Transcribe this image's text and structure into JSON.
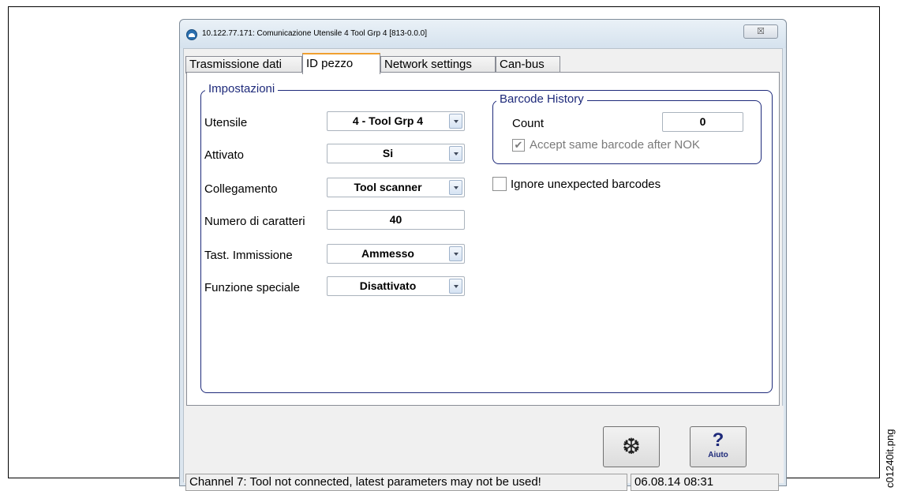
{
  "side_label": "c01240it.png",
  "window": {
    "title": "10.122.77.171: Comunicazione  Utensile 4  Tool Grp 4 [813-0.0.0]",
    "close_glyph": "☒"
  },
  "tabs": [
    {
      "label": "Trasmissione dati"
    },
    {
      "label": "ID pezzo"
    },
    {
      "label": "Network settings"
    },
    {
      "label": "Can-bus"
    }
  ],
  "impostazioni": {
    "title": "Impostazioni",
    "utensile": {
      "label": "Utensile",
      "value": "4 - Tool Grp 4"
    },
    "attivato": {
      "label": "Attivato",
      "value": "Si"
    },
    "collegamento": {
      "label": "Collegamento",
      "value": "Tool scanner"
    },
    "numero": {
      "label": "Numero di caratteri",
      "value": "40"
    },
    "tast": {
      "label": "Tast. Immissione",
      "value": "Ammesso"
    },
    "funzione": {
      "label": "Funzione speciale",
      "value": "Disattivato"
    }
  },
  "barcode_history": {
    "title": "Barcode History",
    "count_label": "Count",
    "count_value": "0",
    "accept_label": "Accept same barcode after NOK",
    "accept_checked": "✔"
  },
  "ignore_label": "Ignore unexpected barcodes",
  "buttons": {
    "snowflake_glyph": "❆",
    "help_glyph": "?",
    "help_label": "Aiuto"
  },
  "status": {
    "message": "Channel 7: Tool not connected, latest parameters may not be used!",
    "datetime": "06.08.14 08:31"
  },
  "colors": {
    "group_border": "#1e2a7a",
    "active_tab_accent": "#f0a030",
    "help_icon": "#1e2a7a"
  }
}
